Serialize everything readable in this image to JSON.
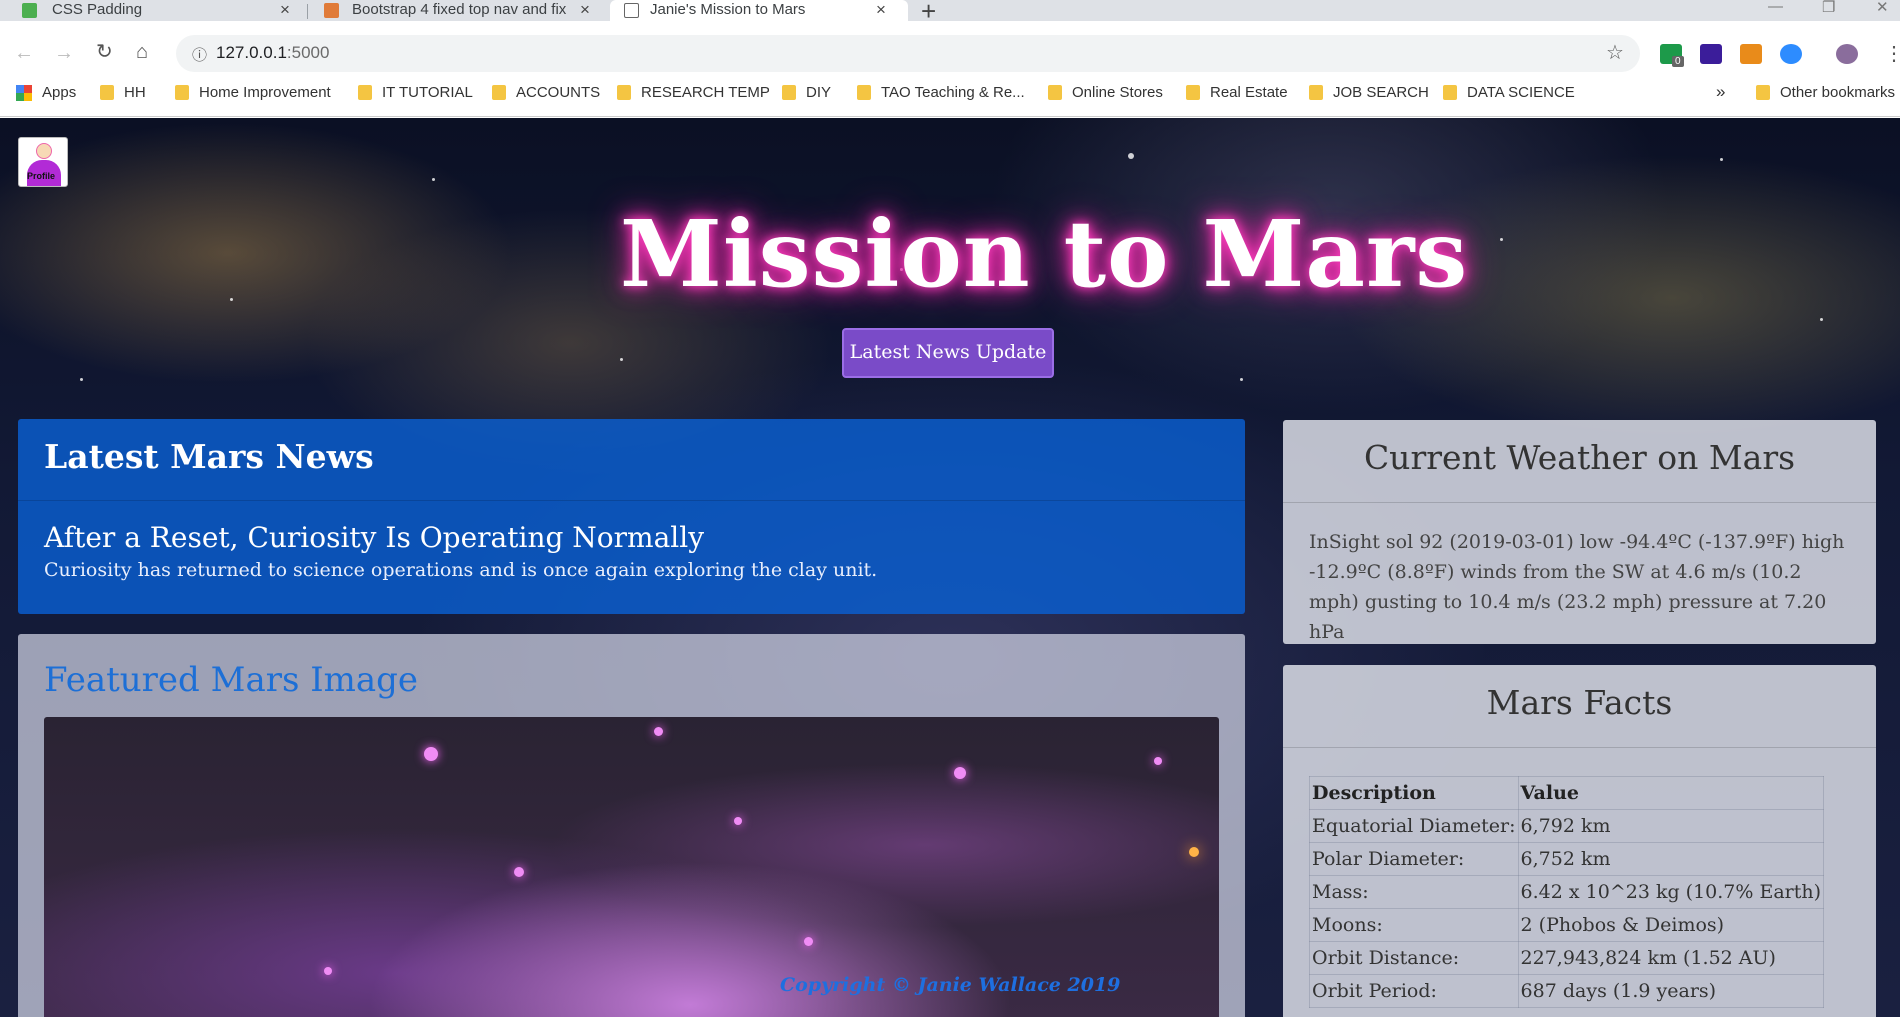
{
  "browser": {
    "tabs": [
      {
        "title": "CSS Padding",
        "favicon_color": "#4caf50",
        "active": false
      },
      {
        "title": "Bootstrap 4 fixed top nav and fix",
        "favicon_color": "#e07b39",
        "active": false
      },
      {
        "title": "Janie's Mission to Mars",
        "favicon_color": "#666666",
        "active": true
      }
    ],
    "new_tab_symbol": "+",
    "address": {
      "host": "127.0.0.1",
      "port": ":5000"
    },
    "bookmarks": [
      {
        "label": "Apps"
      },
      {
        "label": "HH"
      },
      {
        "label": "Home Improvement"
      },
      {
        "label": "IT TUTORIAL"
      },
      {
        "label": "ACCOUNTS"
      },
      {
        "label": "RESEARCH TEMP"
      },
      {
        "label": "DIY"
      },
      {
        "label": "TAO Teaching & Re..."
      },
      {
        "label": "Online Stores"
      },
      {
        "label": "Real Estate"
      },
      {
        "label": "JOB SEARCH"
      },
      {
        "label": "DATA SCIENCE"
      }
    ],
    "overflow_symbol": "»",
    "other_bookmarks": "Other bookmarks",
    "extension_badge": "0",
    "colors": {
      "tabstrip": "#dee1e6",
      "folder": "#f4c542"
    }
  },
  "page": {
    "profile_label": "Profile",
    "title": "Mission to Mars",
    "news_button": "Latest News Update",
    "news": {
      "header": "Latest Mars News",
      "title": "After a Reset, Curiosity Is Operating Normally",
      "paragraph": "Curiosity has returned to science operations and is once again exploring the clay unit."
    },
    "featured": {
      "header": "Featured Mars Image"
    },
    "weather": {
      "header": "Current Weather on Mars",
      "text": "InSight sol 92 (2019-03-01) low -94.4ºC (-137.9ºF) high -12.9ºC (8.8ºF) winds from the SW at 4.6 m/s (10.2 mph) gusting to 10.4 m/s (23.2 mph) pressure at 7.20 hPa"
    },
    "facts": {
      "header": "Mars Facts",
      "columns": [
        "Description",
        "Value"
      ],
      "rows": [
        [
          "Equatorial Diameter:",
          "6,792 km"
        ],
        [
          "Polar Diameter:",
          "6,752 km"
        ],
        [
          "Mass:",
          "6.42 x 10^23 kg (10.7% Earth)"
        ],
        [
          "Moons:",
          "2 (Phobos & Deimos)"
        ],
        [
          "Orbit Distance:",
          "227,943,824 km (1.52 AU)"
        ],
        [
          "Orbit Period:",
          "687 days (1.9 years)"
        ]
      ]
    },
    "copyright": "Copyright © Janie Wallace 2019",
    "colors": {
      "news_card": "#0a5fd2",
      "button": "#7a4bc8",
      "title_glow": "#ff3fc0",
      "link_blue": "#1d6fd6"
    }
  }
}
